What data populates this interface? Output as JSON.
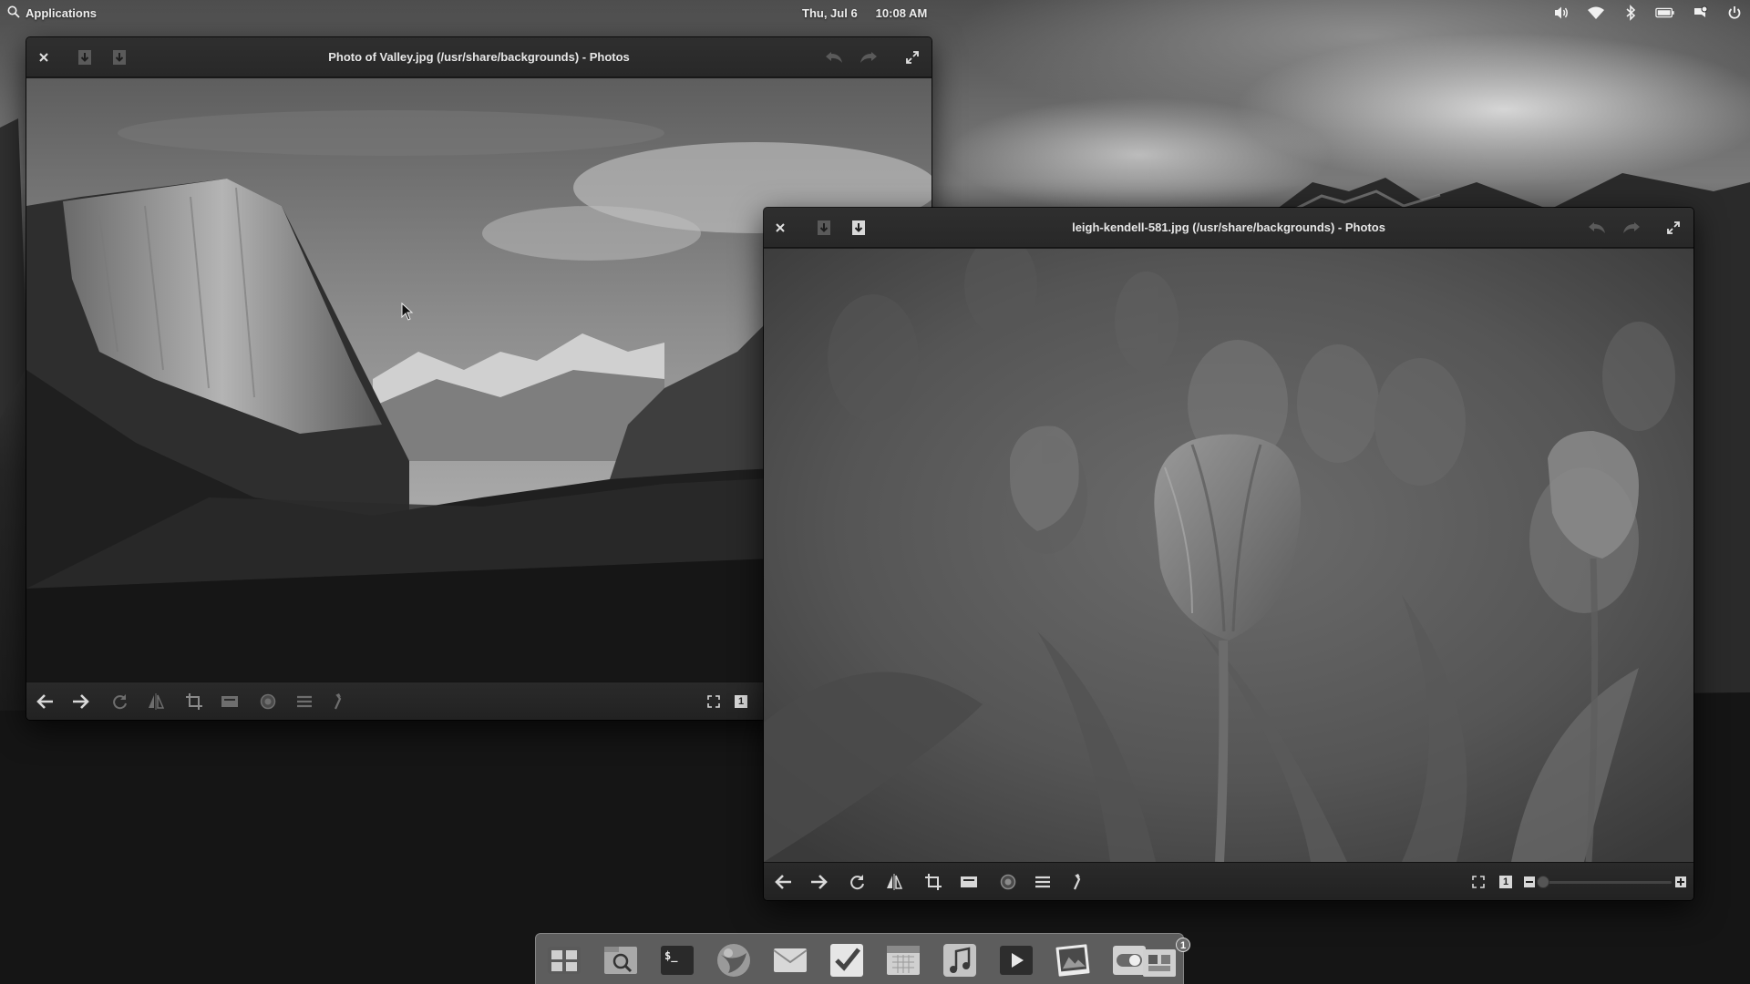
{
  "panel": {
    "applications_label": "Applications",
    "date": "Thu, Jul 6",
    "time": "10:08 AM",
    "indicators": [
      "volume-icon",
      "wifi-icon",
      "bluetooth-icon",
      "battery-icon",
      "notifications-icon",
      "power-icon"
    ]
  },
  "window_valley": {
    "title": "Photo of Valley.jpg (/usr/share/backgrounds) - Photos",
    "zoom_value": "1"
  },
  "window_tulip": {
    "title": "leigh-kendell-581.jpg (/usr/share/backgrounds) - Photos",
    "zoom_value": "1"
  },
  "toolbar_tools": [
    "back-icon",
    "forward-icon",
    "rotate-icon",
    "flip-icon",
    "crop-icon",
    "straighten-icon",
    "redeye-icon",
    "adjust-icon",
    "enhance-icon"
  ],
  "dock": {
    "apps": [
      "multitasking-view",
      "files",
      "terminal",
      "web-browser",
      "mail",
      "tasks",
      "calendar",
      "music",
      "videos",
      "photos",
      "switchboard",
      "app-center"
    ],
    "app_center_badge": "1"
  },
  "colors": {
    "titlebar": "#2c2c2c",
    "toolbar": "#252525",
    "icon": "#d8d8d8",
    "icon_dim": "#8a8a8a"
  }
}
